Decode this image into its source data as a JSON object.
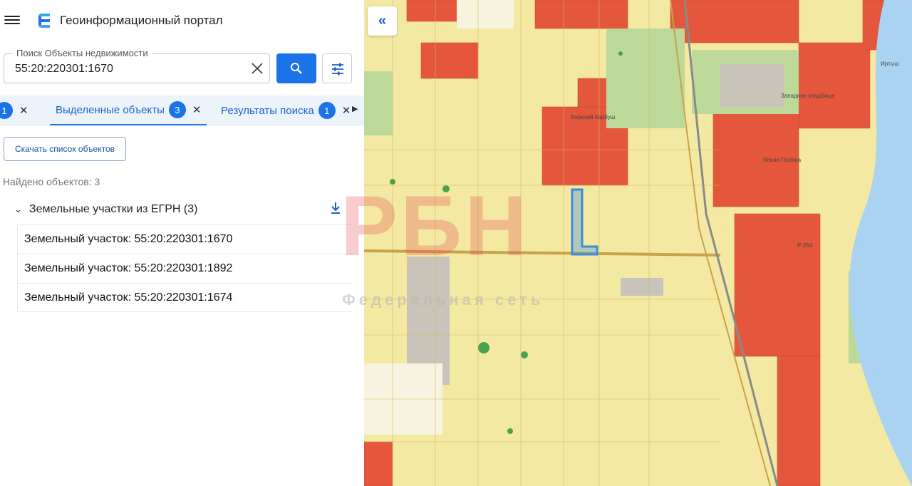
{
  "app": {
    "title": "Геоинформационный портал"
  },
  "search": {
    "legend": "Поиск Объекты недвижимости",
    "value": "55:20:220301:1670"
  },
  "tabs": [
    {
      "label": "",
      "count": "1"
    },
    {
      "label": "Выделенные объекты",
      "count": "3"
    },
    {
      "label": "Результаты поиска",
      "count": "1"
    }
  ],
  "actions": {
    "download_list": "Скачать список объектов"
  },
  "results": {
    "found": "Найдено объектов: 3",
    "group_title": "Земельные участки из ЕГРН (3)",
    "items": [
      "Земельный участок: 55:20:220301:1670",
      "Земельный участок: 55:20:220301:1892",
      "Земельный участок: 55:20:220301:1674"
    ]
  },
  "watermark": {
    "logo": "РБН",
    "text": "Федеральная сеть"
  },
  "map_labels": {
    "cemetery": "Западное кладбище",
    "village1": "Верхний Карбуш",
    "village2": "Ясная Поляна",
    "road": "Р-254",
    "river": "Иртыш"
  },
  "colors": {
    "accent": "#1a73e8",
    "map_yellow": "#f3e9a2",
    "map_red": "#e4573c",
    "map_river": "#aad3f2",
    "selected_parcel": "#3a8de0"
  }
}
